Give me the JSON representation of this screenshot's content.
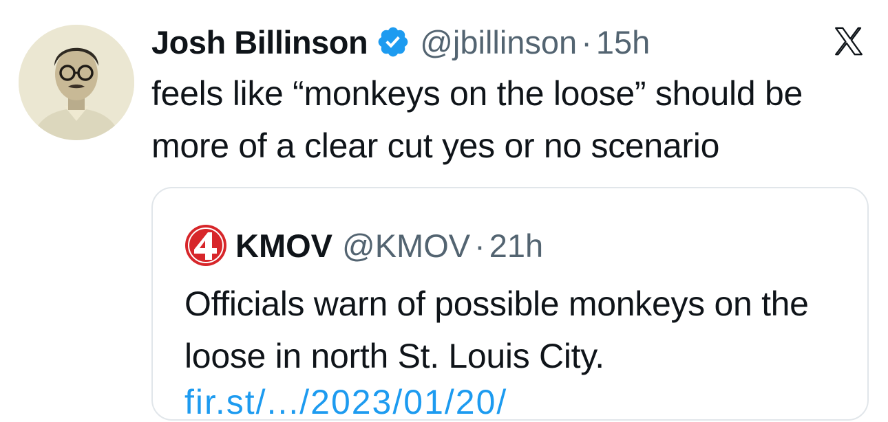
{
  "tweet": {
    "author_name": "Josh Billinson",
    "handle": "@jbillinson",
    "separator": "·",
    "time": "15h",
    "text": "feels like “monkeys on the loose” should be more of a clear cut yes or no scenario",
    "verified": true
  },
  "quoted_tweet": {
    "author_name": "KMOV",
    "handle": "@KMOV",
    "separator": "·",
    "time": "21h",
    "text": "Officials warn of possible monkeys on the loose in north St. Louis City.",
    "link_partial": "fir.st/.../2023/01/20/"
  },
  "icons": {
    "verified": "verified-badge-icon",
    "platform": "x-logo-icon",
    "quote_avatar": "kmov-channel-4-logo"
  },
  "colors": {
    "primary_text": "#0f1419",
    "secondary_text": "#536471",
    "verified_blue": "#1d9bf0",
    "link_blue": "#1d9bf0",
    "kmov_red": "#d7262a",
    "quote_border": "#e1e6ea"
  }
}
